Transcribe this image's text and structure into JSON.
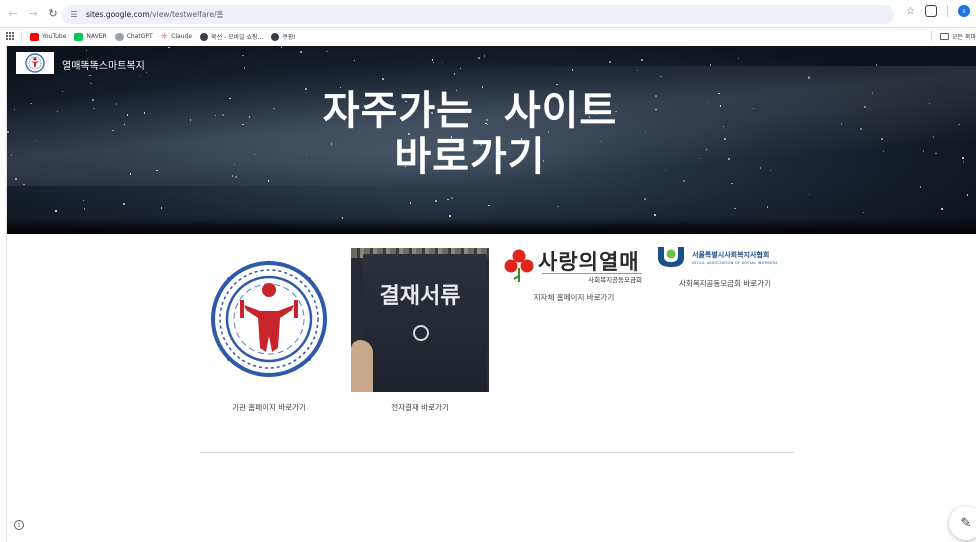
{
  "browser": {
    "url_host": "sites.google.com",
    "url_path": "/view/testwelfare/홈",
    "profile_initial": "s",
    "icons": [
      "back-icon",
      "forward-icon",
      "reload-icon",
      "site-info-icon",
      "star-icon",
      "extensions-icon"
    ]
  },
  "bookmarks": {
    "items": [
      {
        "label": "YouTube",
        "icon": "youtube-icon"
      },
      {
        "label": "NAVER",
        "icon": "naver-icon"
      },
      {
        "label": "ChatGPT",
        "icon": "chatgpt-icon"
      },
      {
        "label": "Claude",
        "icon": "claude-icon"
      },
      {
        "label": "쿡선 - 모바일 쇼핑...",
        "icon": "globe-icon"
      },
      {
        "label": "쿠팡!",
        "icon": "globe-icon"
      }
    ],
    "all_bookmarks_label": "모든 북마"
  },
  "site": {
    "title": "열매똑똑스마트복지",
    "hero_line1": "자주가는  사이트",
    "hero_line2": "바로가기"
  },
  "tiles": [
    {
      "caption": "기관 홈페이지 바로가기"
    },
    {
      "caption": "전자결재 바로가기",
      "cover_text": "결재서류"
    },
    {
      "caption": "지자체 홈페이지 바로가기",
      "logo_text": "사랑의열매",
      "logo_sub": "사회복지공동모금회"
    },
    {
      "caption": "사회복지공동모금회 바로가기",
      "logo_text": "서울특별시사회복지사협회",
      "logo_sub": "SEOUL ASSOCIATION OF SOCIAL WORKERS"
    }
  ],
  "colors": {
    "accent_red": "#e0261b",
    "seoul_blue": "#1b4f8a",
    "seoul_green": "#6abf45",
    "hero_bg": "#1c2633"
  }
}
